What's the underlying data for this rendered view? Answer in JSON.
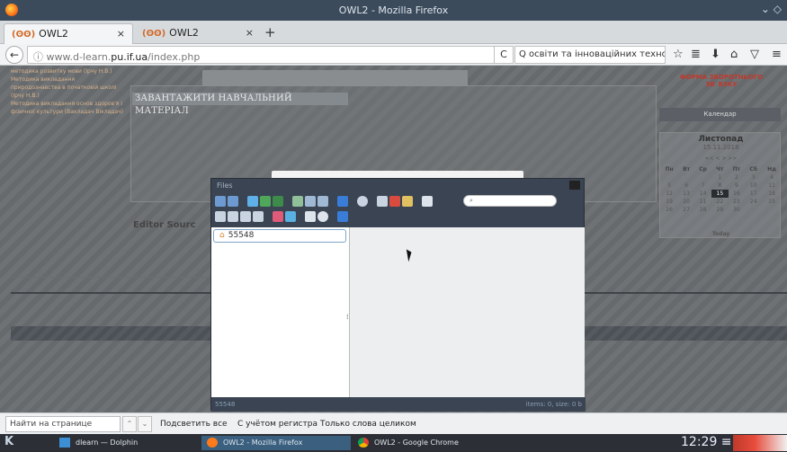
{
  "window": {
    "title": "OWL2 - Mozilla Firefox",
    "controls": "⌄ ◇"
  },
  "tabs": [
    {
      "label": "OWL2",
      "icon": "owl-icon",
      "close": "×"
    },
    {
      "label": "OWL2",
      "icon": "owl-icon",
      "close": "×"
    }
  ],
  "new_tab": "+",
  "nav": {
    "back": "←",
    "url_prefix": "ⓘ  www.d-learn.",
    "url_domain": "pu.if.ua",
    "url_path": "/index.php",
    "reload": "C",
    "search_value": "Q  освіти та інноваційних технологій →",
    "icons": [
      "☆",
      "≣",
      "⬇",
      "⌂",
      "▽",
      "≡"
    ]
  },
  "page": {
    "left_links": [
      "методика розвитку мови (Ірчу Н.В.)",
      "Методика викладання",
      "природознавства в початковій школі",
      "(Ірчу Н.В.)",
      "Методика викладання основ здоров'я і",
      "фізичної культури (Вакладач Вікладач)"
    ],
    "load_button": "ЗАВАНТАЖИТИ НАВЧАЛЬНИЙ МАТЕРІАЛ",
    "editor_tabs": "Editor     Sourc",
    "feedback": "ФОРМА ЗВОРОТНЬОГО ЗВ`ЯЗКУ",
    "calendar_header": "Календар",
    "calendar": {
      "month": "Листопад",
      "date": "15.11.2018",
      "nav": "<<     <      >     >>",
      "weekdays": [
        "Пн",
        "Вт",
        "Ср",
        "Чт",
        "Пт",
        "Сб",
        "Нд"
      ],
      "weeks": [
        [
          "",
          "",
          "",
          "",
          "1",
          "2",
          "3",
          "4"
        ],
        [
          "5",
          "6",
          "7",
          "8",
          "9",
          "10",
          "11"
        ],
        [
          "12",
          "13",
          "14",
          "15",
          "16",
          "17",
          "18"
        ],
        [
          "19",
          "20",
          "21",
          "22",
          "23",
          "24",
          "25"
        ],
        [
          "26",
          "27",
          "28",
          "29",
          "30",
          "",
          ""
        ]
      ],
      "today_label": "Today"
    }
  },
  "dialog": {
    "title": "Files",
    "search_placeholder": "⌕",
    "tree_root": "55548",
    "splitter": "⁞",
    "status_left": "55548",
    "status_right": "items: 0, size: 0 b"
  },
  "findbar": {
    "placeholder": "Найти на странице",
    "prev": "⌃",
    "next": "⌄",
    "options": [
      "Подсветить все",
      "С учётом регистра",
      "Только слова целиком"
    ]
  },
  "taskbar": {
    "start": "K",
    "tasks": [
      "dlearn — Dolphin",
      "OWL2 - Mozilla Firefox",
      "OWL2 - Google Chrome"
    ],
    "clock": "12:29 ≡"
  },
  "colors": {
    "accent_feedback": "#c0392b",
    "dialog_bg": "#3a4452",
    "page_stripe": "#6f7275"
  }
}
